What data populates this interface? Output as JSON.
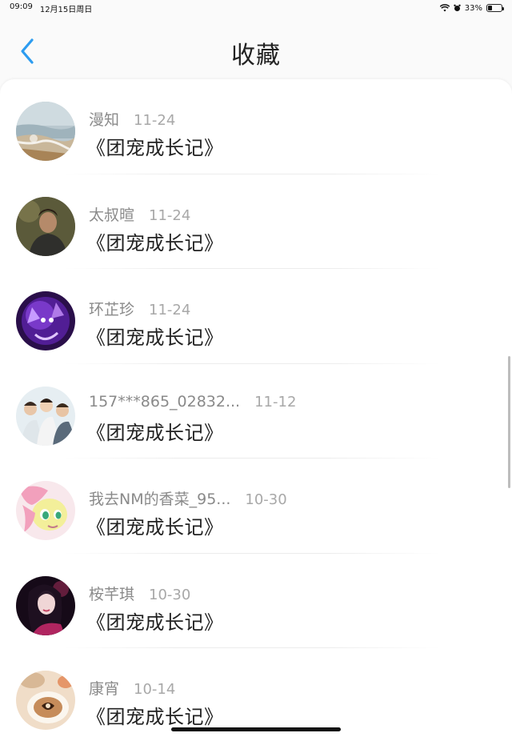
{
  "status_bar": {
    "time": "09:09",
    "date": "12月15日周日",
    "battery": "33%",
    "battery_level": 0.33
  },
  "header": {
    "title": "收藏",
    "back_icon": "chevron-left-icon"
  },
  "colors": {
    "accent": "#2d9cf0",
    "text_primary": "#222222",
    "text_secondary": "#8a8a8a"
  },
  "items": [
    {
      "name": "漫知",
      "date": "11-24",
      "title": "《团宠成长记》",
      "avatar": "beach"
    },
    {
      "name": "太叔暄",
      "date": "11-24",
      "title": "《团宠成长记》",
      "avatar": "man"
    },
    {
      "name": "环芷珍",
      "date": "11-24",
      "title": "《团宠成长记》",
      "avatar": "purple-creature"
    },
    {
      "name": "157***865_02832...",
      "date": "11-12",
      "title": "《团宠成长记》",
      "avatar": "group"
    },
    {
      "name": "我去NM的香菜_95...",
      "date": "10-30",
      "title": "《团宠成长记》",
      "avatar": "pony"
    },
    {
      "name": "桉芊琪",
      "date": "10-30",
      "title": "《团宠成长记》",
      "avatar": "girl"
    },
    {
      "name": "康宵",
      "date": "10-14",
      "title": "《团宠成长记》",
      "avatar": "coffee"
    }
  ]
}
